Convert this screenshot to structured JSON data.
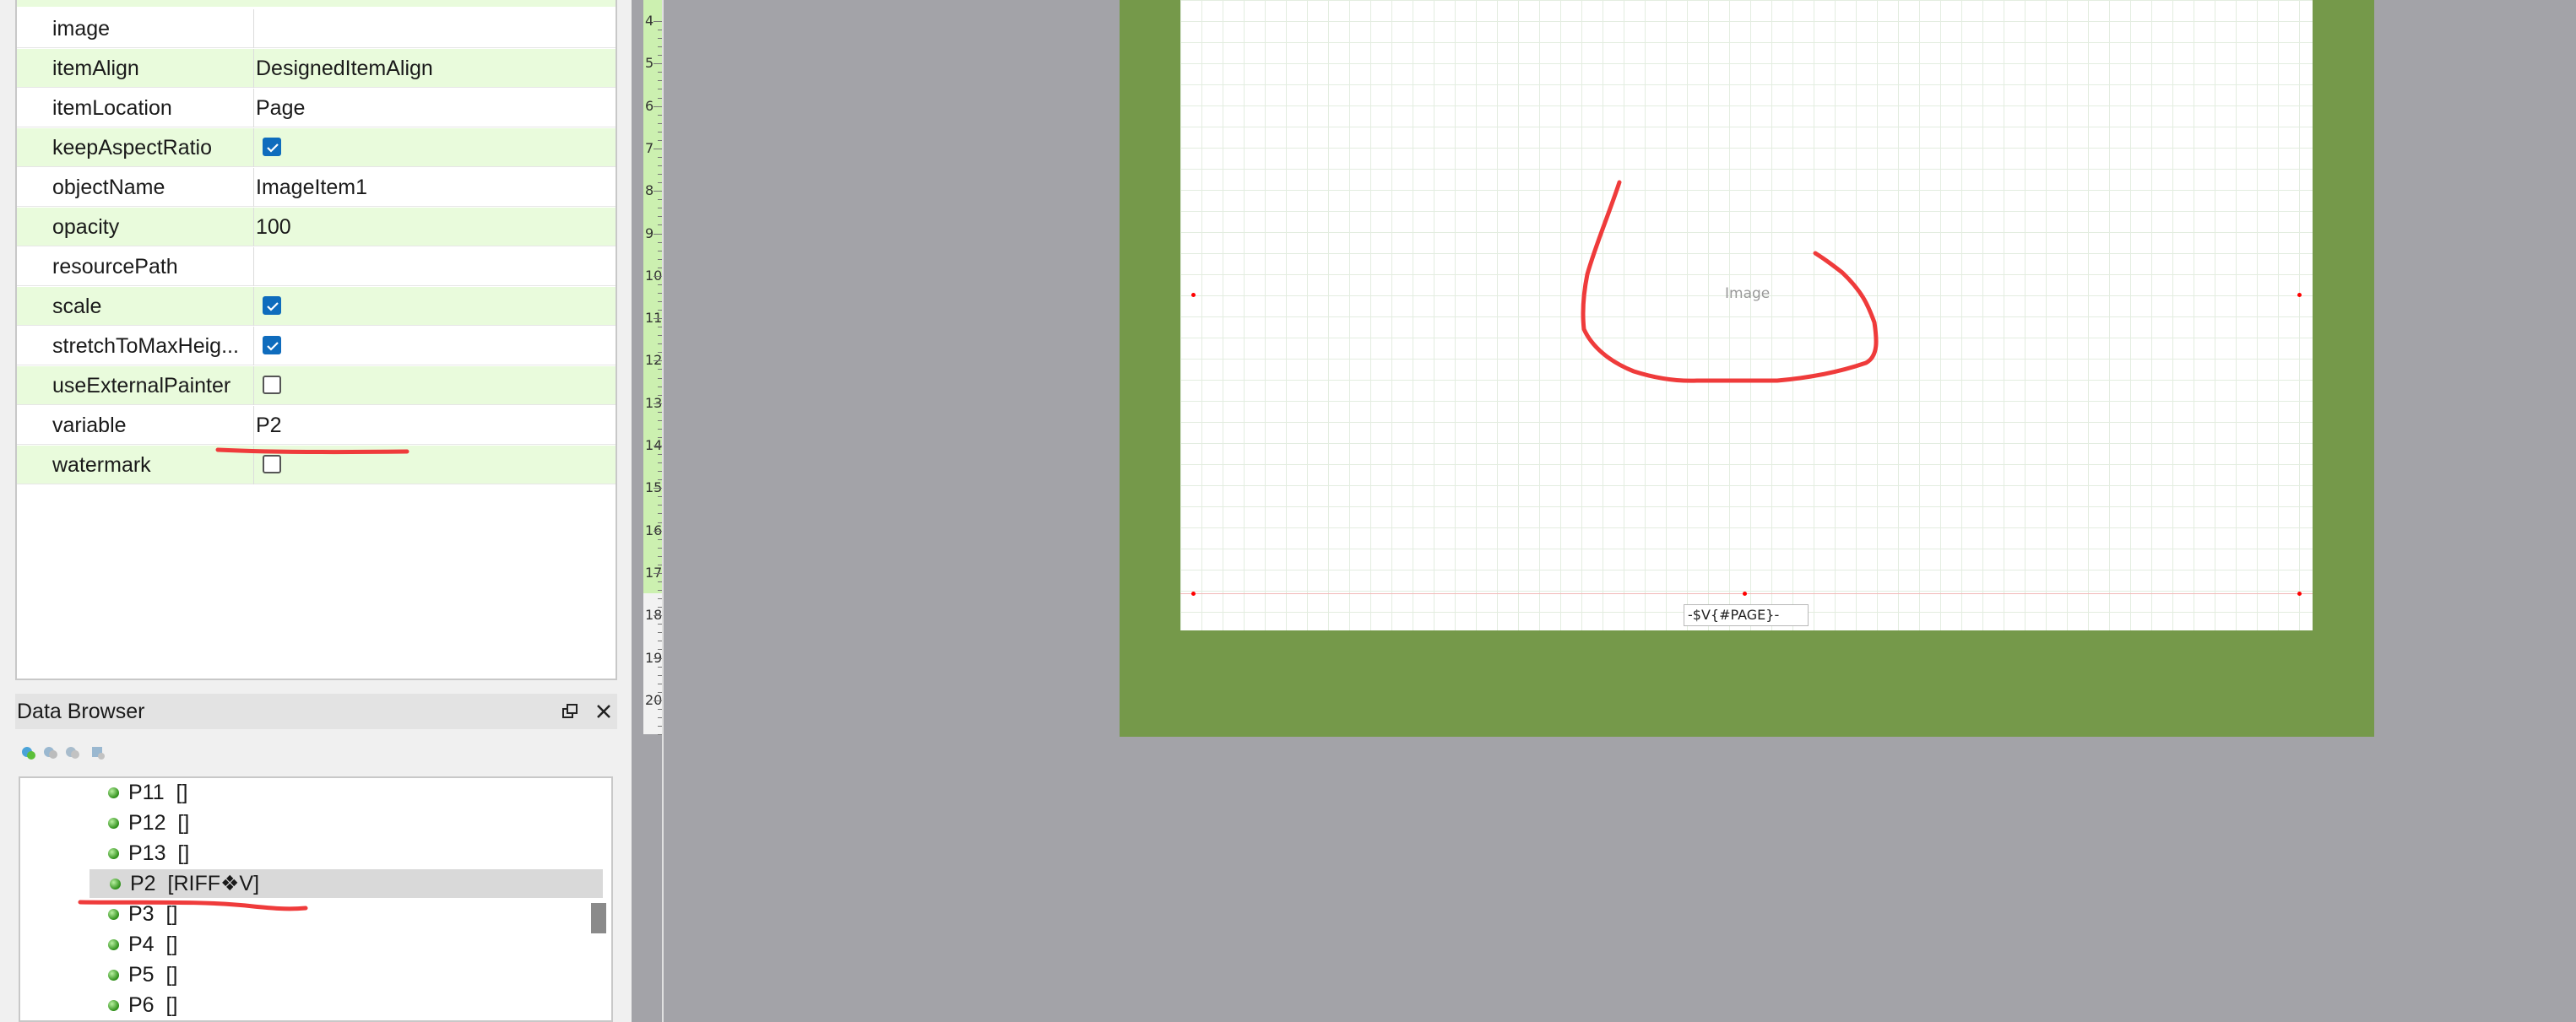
{
  "properties": [
    {
      "name": "image",
      "value": "",
      "type": "text"
    },
    {
      "name": "itemAlign",
      "value": "DesignedItemAlign",
      "type": "text"
    },
    {
      "name": "itemLocation",
      "value": "Page",
      "type": "text"
    },
    {
      "name": "keepAspectRatio",
      "checked": true,
      "type": "checkbox"
    },
    {
      "name": "objectName",
      "value": "ImageItem1",
      "type": "text"
    },
    {
      "name": "opacity",
      "value": "100",
      "type": "text"
    },
    {
      "name": "resourcePath",
      "value": "",
      "type": "text"
    },
    {
      "name": "scale",
      "checked": true,
      "type": "checkbox"
    },
    {
      "name": "stretchToMaxHeig...",
      "checked": true,
      "type": "checkbox"
    },
    {
      "name": "useExternalPainter",
      "checked": false,
      "type": "checkbox"
    },
    {
      "name": "variable",
      "value": "P2",
      "type": "text"
    },
    {
      "name": "watermark",
      "checked": false,
      "type": "checkbox"
    }
  ],
  "data_browser": {
    "title": "Data Browser",
    "items": [
      {
        "name": "P11",
        "value": "[]",
        "selected": false
      },
      {
        "name": "P12",
        "value": "[]",
        "selected": false
      },
      {
        "name": "P13",
        "value": "[]",
        "selected": false
      },
      {
        "name": "P2",
        "value": "[RIFF❖V]",
        "selected": true
      },
      {
        "name": "P3",
        "value": "[]",
        "selected": false
      },
      {
        "name": "P4",
        "value": "[]",
        "selected": false
      },
      {
        "name": "P5",
        "value": "[]",
        "selected": false
      },
      {
        "name": "P6",
        "value": "[]",
        "selected": false
      }
    ]
  },
  "ruler": {
    "numbers": [
      "4",
      "5",
      "6",
      "7",
      "8",
      "9",
      "10",
      "11",
      "12",
      "13",
      "14",
      "15",
      "16",
      "17",
      "18",
      "19",
      "20"
    ]
  },
  "canvas": {
    "image_placeholder": "Image",
    "page_field": "-$V{#PAGE}-"
  },
  "colors": {
    "property_row_highlight": "#e9fbdc",
    "page_frame": "#75994a",
    "canvas_background": "#a3a3a8",
    "annotation": "#ef3b3b",
    "checkbox_checked": "#0f6cbd"
  }
}
